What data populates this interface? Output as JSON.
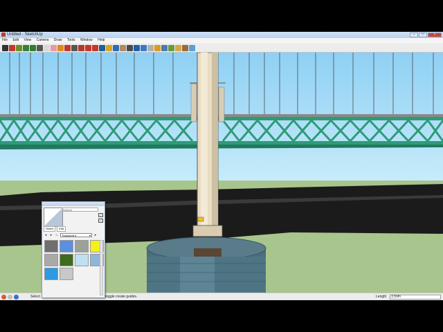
{
  "app": {
    "window_title": "Untitled - SketchUp"
  },
  "menu": [
    "File",
    "Edit",
    "View",
    "Camera",
    "Draw",
    "Tools",
    "Window",
    "Help"
  ],
  "toolbar": {
    "tools": [
      {
        "name": "select-tool-icon",
        "color": "#333333"
      },
      {
        "name": "pencil-tool-icon",
        "color": "#c0392b"
      },
      {
        "name": "rectangle-tool-icon",
        "color": "#6b8e23"
      },
      {
        "name": "circle-tool-icon",
        "color": "#3a7d3a"
      },
      {
        "name": "polygon-tool-icon",
        "color": "#2e7d32"
      },
      {
        "name": "arc-tool-icon",
        "color": "#555555"
      },
      {
        "name": "make-component-icon",
        "color": "#d9d9d9"
      },
      {
        "name": "eraser-tool-icon",
        "color": "#e89aa0"
      },
      {
        "name": "paint-bucket-icon",
        "color": "#d98c1f"
      },
      {
        "name": "push-pull-icon",
        "color": "#c0392b"
      },
      {
        "name": "follow-me-icon",
        "color": "#555555"
      },
      {
        "name": "move-tool-icon",
        "color": "#b03a2e"
      },
      {
        "name": "rotate-tool-icon",
        "color": "#c0392b"
      },
      {
        "name": "scale-tool-icon",
        "color": "#c0392b"
      },
      {
        "name": "offset-tool-icon",
        "color": "#1f5f99"
      },
      {
        "name": "tape-measure-icon",
        "color": "#d8a520"
      },
      {
        "name": "orbit-tool-icon",
        "color": "#2c6db5"
      },
      {
        "name": "pan-tool-icon",
        "color": "#b08968"
      },
      {
        "name": "zoom-tool-icon",
        "color": "#4a4a4a"
      },
      {
        "name": "zoom-extents-icon",
        "color": "#1e5fa8"
      },
      {
        "name": "previous-view-icon",
        "color": "#3a78c2"
      },
      {
        "name": "next-view-icon",
        "color": "#b0b0b0"
      },
      {
        "name": "get-models-icon",
        "color": "#d89c20"
      },
      {
        "name": "share-model-icon",
        "color": "#4a7ab8"
      },
      {
        "name": "get-photo-texture-icon",
        "color": "#6a9a3a"
      },
      {
        "name": "add-location-icon",
        "color": "#d4a84a"
      },
      {
        "name": "toggle-terrain-icon",
        "color": "#9a6a3a"
      },
      {
        "name": "preview-google-earth-icon",
        "color": "#5aa0d8"
      }
    ]
  },
  "materials": {
    "material_name": "Default",
    "tabs": [
      "Select",
      "Edit"
    ],
    "category": "Translucent",
    "swatches": [
      {
        "name": "tile-swatch",
        "color": "#6f6f6f"
      },
      {
        "name": "glass-blue-swatch",
        "color": "#5c8fe0"
      },
      {
        "name": "glass-gray-swatch",
        "color": "#9aa29a"
      },
      {
        "name": "glass-yellow-swatch",
        "color": "#f3f01a"
      },
      {
        "name": "glass-silver-swatch",
        "color": "#a9a9a9"
      },
      {
        "name": "glass-green-swatch",
        "color": "#3f6b1e"
      },
      {
        "name": "glass-sky-swatch",
        "color": "#bfe0f2"
      },
      {
        "name": "glass-light-blue-swatch",
        "color": "#8fb5d8"
      },
      {
        "name": "glass-cyan-swatch",
        "color": "#2e9ae2"
      },
      {
        "name": "glass-frosted-swatch",
        "color": "#c8c8c8"
      }
    ]
  },
  "status": {
    "msg1": "Select",
    "msg2": "toggle create guides.",
    "measure_label": "Length",
    "measure_value": "3,59m"
  },
  "colors": {
    "truss_green": "#2f9a78",
    "sky_top": "#8fd0f4",
    "ground": "#a8c58d",
    "column_light": "#e8dcc2",
    "pier_top": "#5a7c8a"
  }
}
